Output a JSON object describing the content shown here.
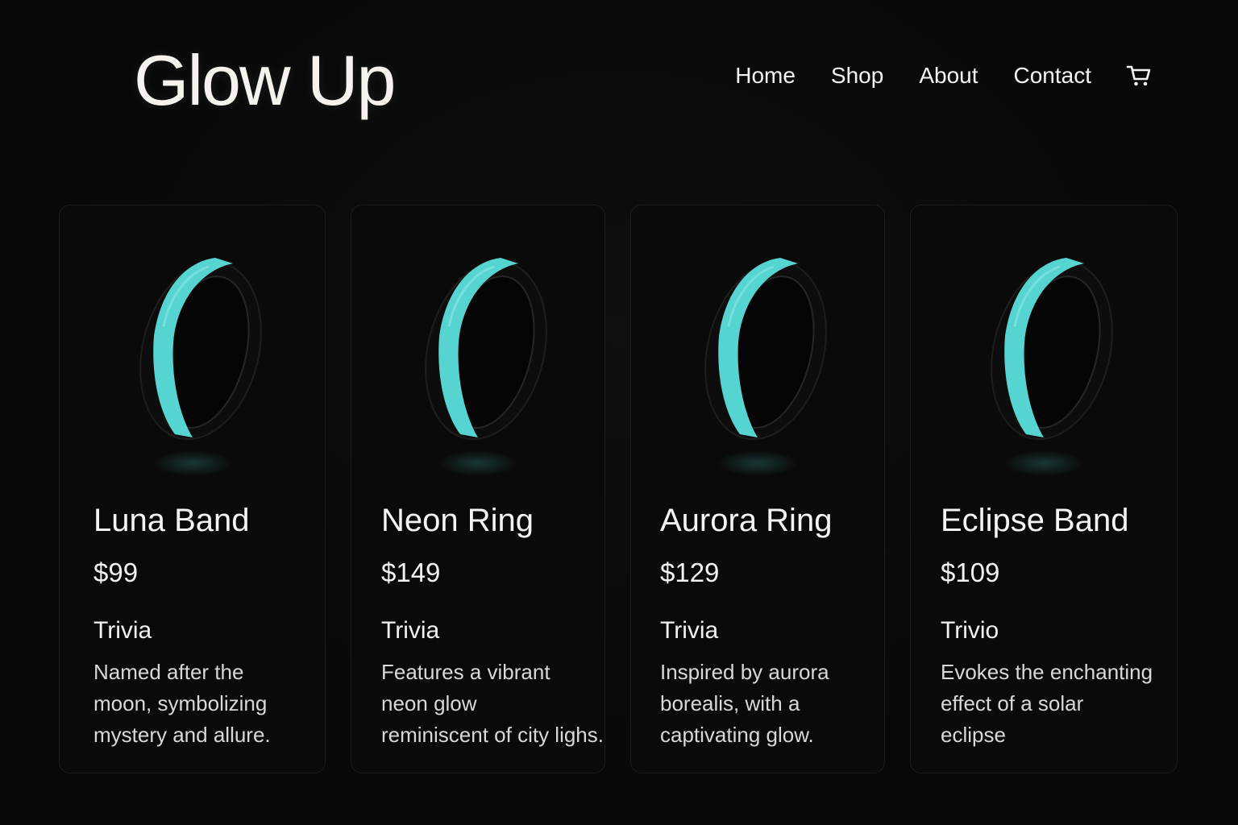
{
  "header": {
    "brand": "Glow Up",
    "nav": [
      "Home",
      "Shop",
      "About",
      "Contact"
    ],
    "cart_icon": "cart-icon"
  },
  "colors": {
    "background": "#090909",
    "glow": "#4fd6d6",
    "text": "#f2f2f2"
  },
  "products": [
    {
      "name": "Luna Band",
      "price": "$99",
      "subtitle": "Trivia",
      "desc": [
        "Named after the",
        "moon, symbolizing",
        "mystery and allure."
      ]
    },
    {
      "name": "Neon Ring",
      "price": "$149",
      "subtitle": "Trivia",
      "desc": [
        "Features a vibrant",
        "neon glow",
        "reminiscent of city lighs."
      ]
    },
    {
      "name": "Aurora Ring",
      "price": "$129",
      "subtitle": "Trivia",
      "desc": [
        "Inspired by aurora",
        "borealis, with a",
        "captivating glow."
      ]
    },
    {
      "name": "Eclipse Band",
      "price": "$109",
      "subtitle": "Trivio",
      "desc": [
        "Evokes the enchanting",
        "effect of a solar",
        "eclipse"
      ]
    }
  ]
}
